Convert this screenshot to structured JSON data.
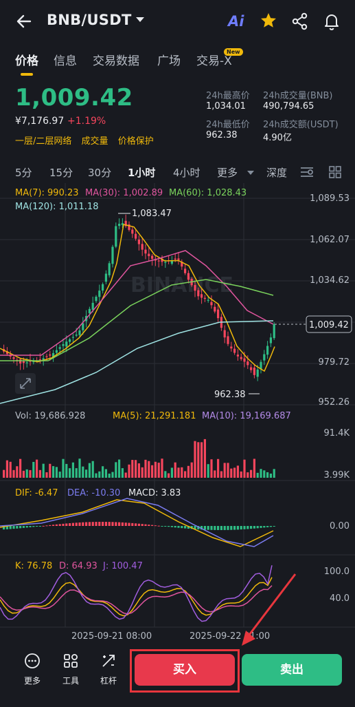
{
  "header": {
    "pair": "BNB/USDT",
    "ai_label": "Ai"
  },
  "tabs": [
    {
      "label": "价格",
      "active": true
    },
    {
      "label": "信息",
      "active": false
    },
    {
      "label": "交易数据",
      "active": false
    },
    {
      "label": "广场",
      "active": false
    },
    {
      "label": "交易-X",
      "active": false,
      "badge": "New"
    }
  ],
  "price": {
    "last": "1,009.42",
    "cny": "¥7,176.97",
    "change": "+1.19%",
    "tags": [
      "一层/二层网络",
      "成交量",
      "价格保护"
    ]
  },
  "stats": {
    "high_label": "24h最高价",
    "high_value": "1,034.01",
    "vol_bnb_label": "24h成交量(BNB)",
    "vol_bnb_value": "490,794.65",
    "low_label": "24h最低价",
    "low_value": "962.38",
    "vol_usdt_label": "24h成交额(USDT)",
    "vol_usdt_value": "4.90亿"
  },
  "intervals": {
    "items": [
      "5分",
      "15分",
      "30分",
      "1小时",
      "4小时",
      "更多",
      "深度"
    ],
    "active": "1小时"
  },
  "ma": {
    "ma7": "MA(7): 990.23",
    "ma30": "MA(30): 1,002.89",
    "ma60": "MA(60): 1,028.43",
    "ma120": "MA(120): 1,011.18"
  },
  "price_axis": [
    "1,089.53",
    "1,062.07",
    "1,034.62",
    "979.72",
    "952.26"
  ],
  "current_price_tag": "1,009.42",
  "high_marker": "1,083.47",
  "low_marker": "962.38",
  "watermark": "BINANCE",
  "volume": {
    "vol": "Vol: 19,686.928",
    "ma5": "MA(5): 21,291.181",
    "ma10": "MA(10): 19,169.687",
    "axis_top": "91.4K",
    "axis_bottom": "3.99K"
  },
  "macd": {
    "dif": "DIF: -6.47",
    "dea": "DEA: -10.30",
    "macd": "MACD: 3.83",
    "axis_zero": "0.00"
  },
  "kdj": {
    "k": "K: 76.78",
    "d": "D: 64.93",
    "j": "J: 100.47",
    "axis_top": "100.0",
    "axis_mid": "40.0"
  },
  "time_axis": [
    "2025-09-21 08:00",
    "2025-09-22 01:00"
  ],
  "bottom": {
    "more": "更多",
    "tools": "工具",
    "leverage": "杠杆",
    "buy": "买入",
    "sell": "卖出"
  },
  "colors": {
    "up": "#2ebd85",
    "down": "#f6465d",
    "accent": "#f0b90b",
    "ma7": "#f0b90b",
    "ma30": "#e0559e",
    "ma60": "#7ad35c",
    "ma120": "#9fe3e3",
    "dea": "#7b7cf0",
    "kdj_j": "#a25ee0"
  }
}
